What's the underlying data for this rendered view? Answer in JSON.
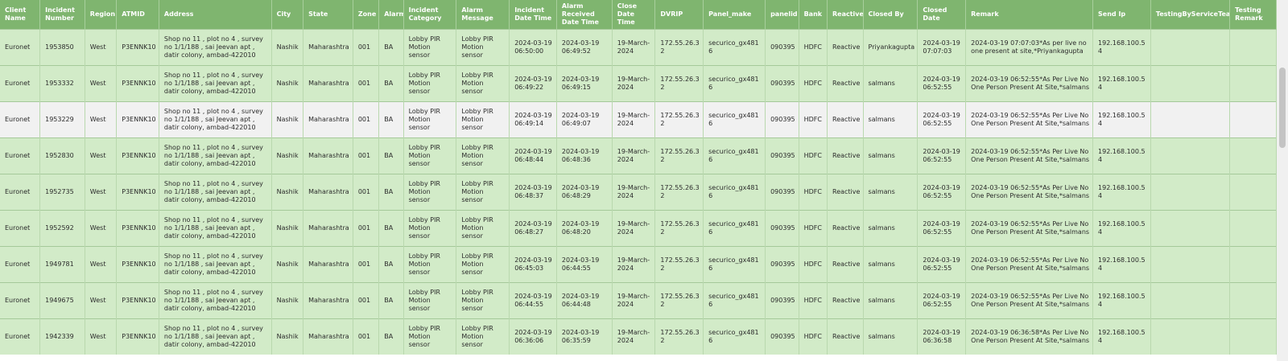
{
  "table": {
    "headers": [
      "Client Name",
      "Incident Number",
      "Region",
      "ATMID",
      "Address",
      "City",
      "State",
      "Zone",
      "Alarm",
      "Incident Category",
      "Alarm Message",
      "Incident Date Time",
      "Alarm Received Date Time",
      "Close Date Time",
      "DVRIP",
      "Panel_make",
      "panelid",
      "Bank",
      "Reactive",
      "Closed By",
      "Closed Date",
      "Remark",
      "Send Ip",
      "TestingByServiceTeam",
      "Testing Remark"
    ],
    "rows": [
      [
        "Euronet",
        "1953850",
        "West",
        "P3ENNK10",
        "Shop no 11 , plot no 4 , survey no 1/1/188 , sai Jeevan apt , datir colony, ambad-422010",
        "Nashik",
        "Maharashtra",
        "001",
        "BA",
        "Lobby PIR Motion sensor",
        "Lobby PIR Motion sensor",
        "2024-03-19 06:50:00",
        "2024-03-19 06:49:52",
        "19-March-2024",
        "172.55.26.32",
        "securico_gx4816",
        "090395",
        "HDFC",
        "Reactive",
        "Priyankagupta",
        "2024-03-19 07:07:03",
        "2024-03-19 07:07:03*As per live no one present at site,*Priyankagupta",
        "192.168.100.54",
        "",
        ""
      ],
      [
        "Euronet",
        "1953332",
        "West",
        "P3ENNK10",
        "Shop no 11 , plot no 4 , survey no 1/1/188 , sai Jeevan apt , datir colony, ambad-422010",
        "Nashik",
        "Maharashtra",
        "001",
        "BA",
        "Lobby PIR Motion sensor",
        "Lobby PIR Motion sensor",
        "2024-03-19 06:49:22",
        "2024-03-19 06:49:15",
        "19-March-2024",
        "172.55.26.32",
        "securico_gx4816",
        "090395",
        "HDFC",
        "Reactive",
        "salmans",
        "2024-03-19 06:52:55",
        "2024-03-19 06:52:55*As Per Live No One Person Present At Site,*salmans",
        "192.168.100.54",
        "",
        ""
      ],
      [
        "Euronet",
        "1953229",
        "West",
        "P3ENNK10",
        "Shop no 11 , plot no 4 , survey no 1/1/188 , sai Jeevan apt , datir colony, ambad-422010",
        "Nashik",
        "Maharashtra",
        "001",
        "BA",
        "Lobby PIR Motion sensor",
        "Lobby PIR Motion sensor",
        "2024-03-19 06:49:14",
        "2024-03-19 06:49:07",
        "19-March-2024",
        "172.55.26.32",
        "securico_gx4816",
        "090395",
        "HDFC",
        "Reactive",
        "salmans",
        "2024-03-19 06:52:55",
        "2024-03-19 06:52:55*As Per Live No One Person Present At Site,*salmans",
        "192.168.100.54",
        "",
        ""
      ],
      [
        "Euronet",
        "1952830",
        "West",
        "P3ENNK10",
        "Shop no 11 , plot no 4 , survey no 1/1/188 , sai Jeevan apt , datir colony, ambad-422010",
        "Nashik",
        "Maharashtra",
        "001",
        "BA",
        "Lobby PIR Motion sensor",
        "Lobby PIR Motion sensor",
        "2024-03-19 06:48:44",
        "2024-03-19 06:48:36",
        "19-March-2024",
        "172.55.26.32",
        "securico_gx4816",
        "090395",
        "HDFC",
        "Reactive",
        "salmans",
        "2024-03-19 06:52:55",
        "2024-03-19 06:52:55*As Per Live No One Person Present At Site,*salmans",
        "192.168.100.54",
        "",
        ""
      ],
      [
        "Euronet",
        "1952735",
        "West",
        "P3ENNK10",
        "Shop no 11 , plot no 4 , survey no 1/1/188 , sai Jeevan apt , datir colony, ambad-422010",
        "Nashik",
        "Maharashtra",
        "001",
        "BA",
        "Lobby PIR Motion sensor",
        "Lobby PIR Motion sensor",
        "2024-03-19 06:48:37",
        "2024-03-19 06:48:29",
        "19-March-2024",
        "172.55.26.32",
        "securico_gx4816",
        "090395",
        "HDFC",
        "Reactive",
        "salmans",
        "2024-03-19 06:52:55",
        "2024-03-19 06:52:55*As Per Live No One Person Present At Site,*salmans",
        "192.168.100.54",
        "",
        ""
      ],
      [
        "Euronet",
        "1952592",
        "West",
        "P3ENNK10",
        "Shop no 11 , plot no 4 , survey no 1/1/188 , sai Jeevan apt , datir colony, ambad-422010",
        "Nashik",
        "Maharashtra",
        "001",
        "BA",
        "Lobby PIR Motion sensor",
        "Lobby PIR Motion sensor",
        "2024-03-19 06:48:27",
        "2024-03-19 06:48:20",
        "19-March-2024",
        "172.55.26.32",
        "securico_gx4816",
        "090395",
        "HDFC",
        "Reactive",
        "salmans",
        "2024-03-19 06:52:55",
        "2024-03-19 06:52:55*As Per Live No One Person Present At Site,*salmans",
        "192.168.100.54",
        "",
        ""
      ],
      [
        "Euronet",
        "1949781",
        "West",
        "P3ENNK10",
        "Shop no 11 , plot no 4 , survey no 1/1/188 , sai Jeevan apt , datir colony, ambad-422010",
        "Nashik",
        "Maharashtra",
        "001",
        "BA",
        "Lobby PIR Motion sensor",
        "Lobby PIR Motion sensor",
        "2024-03-19 06:45:03",
        "2024-03-19 06:44:55",
        "19-March-2024",
        "172.55.26.32",
        "securico_gx4816",
        "090395",
        "HDFC",
        "Reactive",
        "salmans",
        "2024-03-19 06:52:55",
        "2024-03-19 06:52:55*As Per Live No One Person Present At Site,*salmans",
        "192.168.100.54",
        "",
        ""
      ],
      [
        "Euronet",
        "1949675",
        "West",
        "P3ENNK10",
        "Shop no 11 , plot no 4 , survey no 1/1/188 , sai Jeevan apt , datir colony, ambad-422010",
        "Nashik",
        "Maharashtra",
        "001",
        "BA",
        "Lobby PIR Motion sensor",
        "Lobby PIR Motion sensor",
        "2024-03-19 06:44:55",
        "2024-03-19 06:44:48",
        "19-March-2024",
        "172.55.26.32",
        "securico_gx4816",
        "090395",
        "HDFC",
        "Reactive",
        "salmans",
        "2024-03-19 06:52:55",
        "2024-03-19 06:52:55*As Per Live No One Person Present At Site,*salmans",
        "192.168.100.54",
        "",
        ""
      ],
      [
        "Euronet",
        "1942339",
        "West",
        "P3ENNK10",
        "Shop no 11 , plot no 4 , survey no 1/1/188 , sai Jeevan apt , datir colony, ambad-422010",
        "Nashik",
        "Maharashtra",
        "001",
        "BA",
        "Lobby PIR Motion sensor",
        "Lobby PIR Motion sensor",
        "2024-03-19 06:36:06",
        "2024-03-19 06:35:59",
        "19-March-2024",
        "172.55.26.32",
        "securico_gx4816",
        "090395",
        "HDFC",
        "Reactive",
        "salmans",
        "2024-03-19 06:36:58",
        "2024-03-19 06:36:58*As Per Live No One Person Present At Site,*salmans",
        "192.168.100.54",
        "",
        ""
      ]
    ]
  },
  "colors": {
    "header_bg": "#7fb56f",
    "row_bg": "#d2ebc8",
    "row_alt_bg": "#f1f1f1",
    "header_text": "#ffffff"
  }
}
